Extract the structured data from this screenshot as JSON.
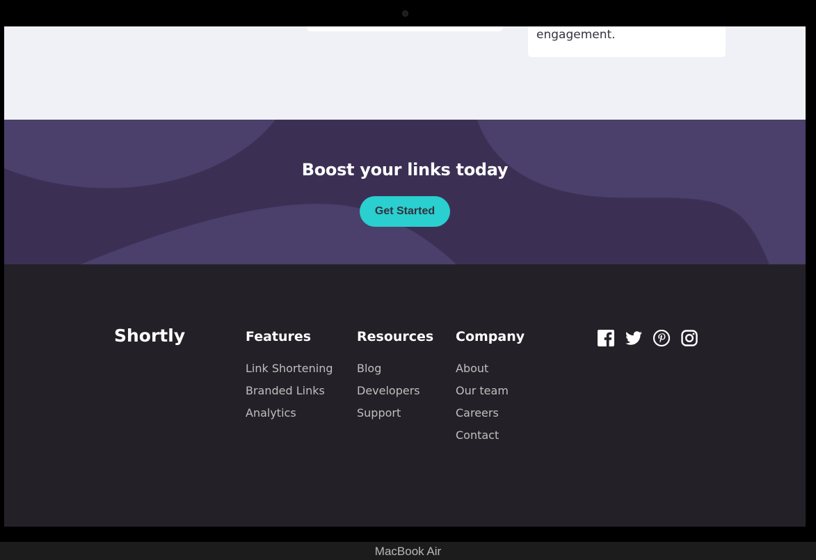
{
  "stats": {
    "card_text": "engagement."
  },
  "boost": {
    "title": "Boost your links today",
    "cta_label": "Get Started"
  },
  "footer": {
    "logo": "Shortly",
    "columns": [
      {
        "heading": "Features",
        "links": [
          "Link Shortening",
          "Branded Links",
          "Analytics"
        ]
      },
      {
        "heading": "Resources",
        "links": [
          "Blog",
          "Developers",
          "Support"
        ]
      },
      {
        "heading": "Company",
        "links": [
          "About",
          "Our team",
          "Careers",
          "Contact"
        ]
      }
    ],
    "socials": [
      "facebook-icon",
      "twitter-icon",
      "pinterest-icon",
      "instagram-icon"
    ]
  },
  "device": {
    "label": "MacBook Air"
  },
  "colors": {
    "cyan": "#2acfcf",
    "dark_violet": "#3b3054",
    "footer_bg": "#232127",
    "light_bg": "#f0f1f6"
  }
}
